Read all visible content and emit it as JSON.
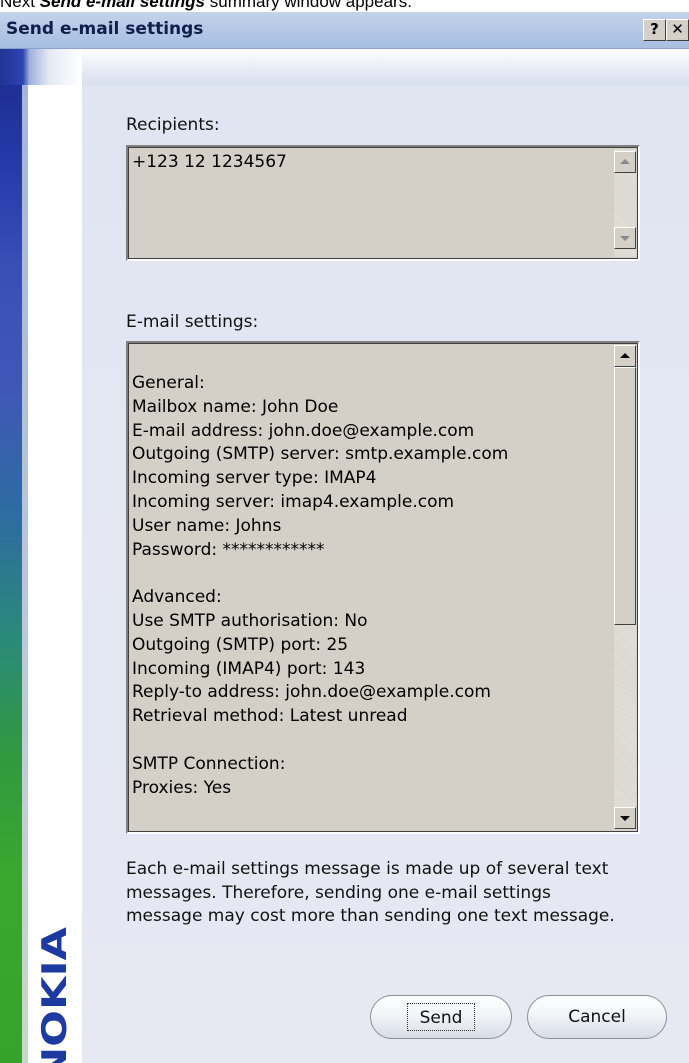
{
  "caption": {
    "prefix": "Next ",
    "emphasis": "Send e-mail settings",
    "suffix": " summary window appears."
  },
  "window": {
    "title": "Send e-mail settings",
    "help_button": "?",
    "close_button": "✕"
  },
  "brand": {
    "logo_text": "NOKIA",
    "logo_color": "#1c3aa0"
  },
  "recipients": {
    "label": "Recipients:",
    "value": "+123 12 1234567"
  },
  "email_settings": {
    "label": "E-mail settings:",
    "lines": [
      "General:",
      "Mailbox name: John Doe",
      "E-mail address: john.doe@example.com",
      "Outgoing (SMTP) server: smtp.example.com",
      "Incoming server type: IMAP4",
      "Incoming server: imap4.example.com",
      "User name: Johns",
      "Password: ************",
      "",
      "Advanced:",
      "Use SMTP authorisation: No",
      "Outgoing (SMTP) port: 25",
      "Incoming (IMAP4) port: 143",
      "Reply-to address: john.doe@example.com",
      "Retrieval method: Latest unread",
      "",
      "SMTP Connection:",
      "Proxies: Yes"
    ]
  },
  "note": "Each e-mail settings message is made up of several text messages. Therefore, sending one e-mail settings message may cost more than sending one text message.",
  "buttons": {
    "send": "Send",
    "cancel": "Cancel"
  },
  "icons": {
    "scroll_up": "triangle-up-icon",
    "scroll_down": "triangle-down-icon"
  }
}
